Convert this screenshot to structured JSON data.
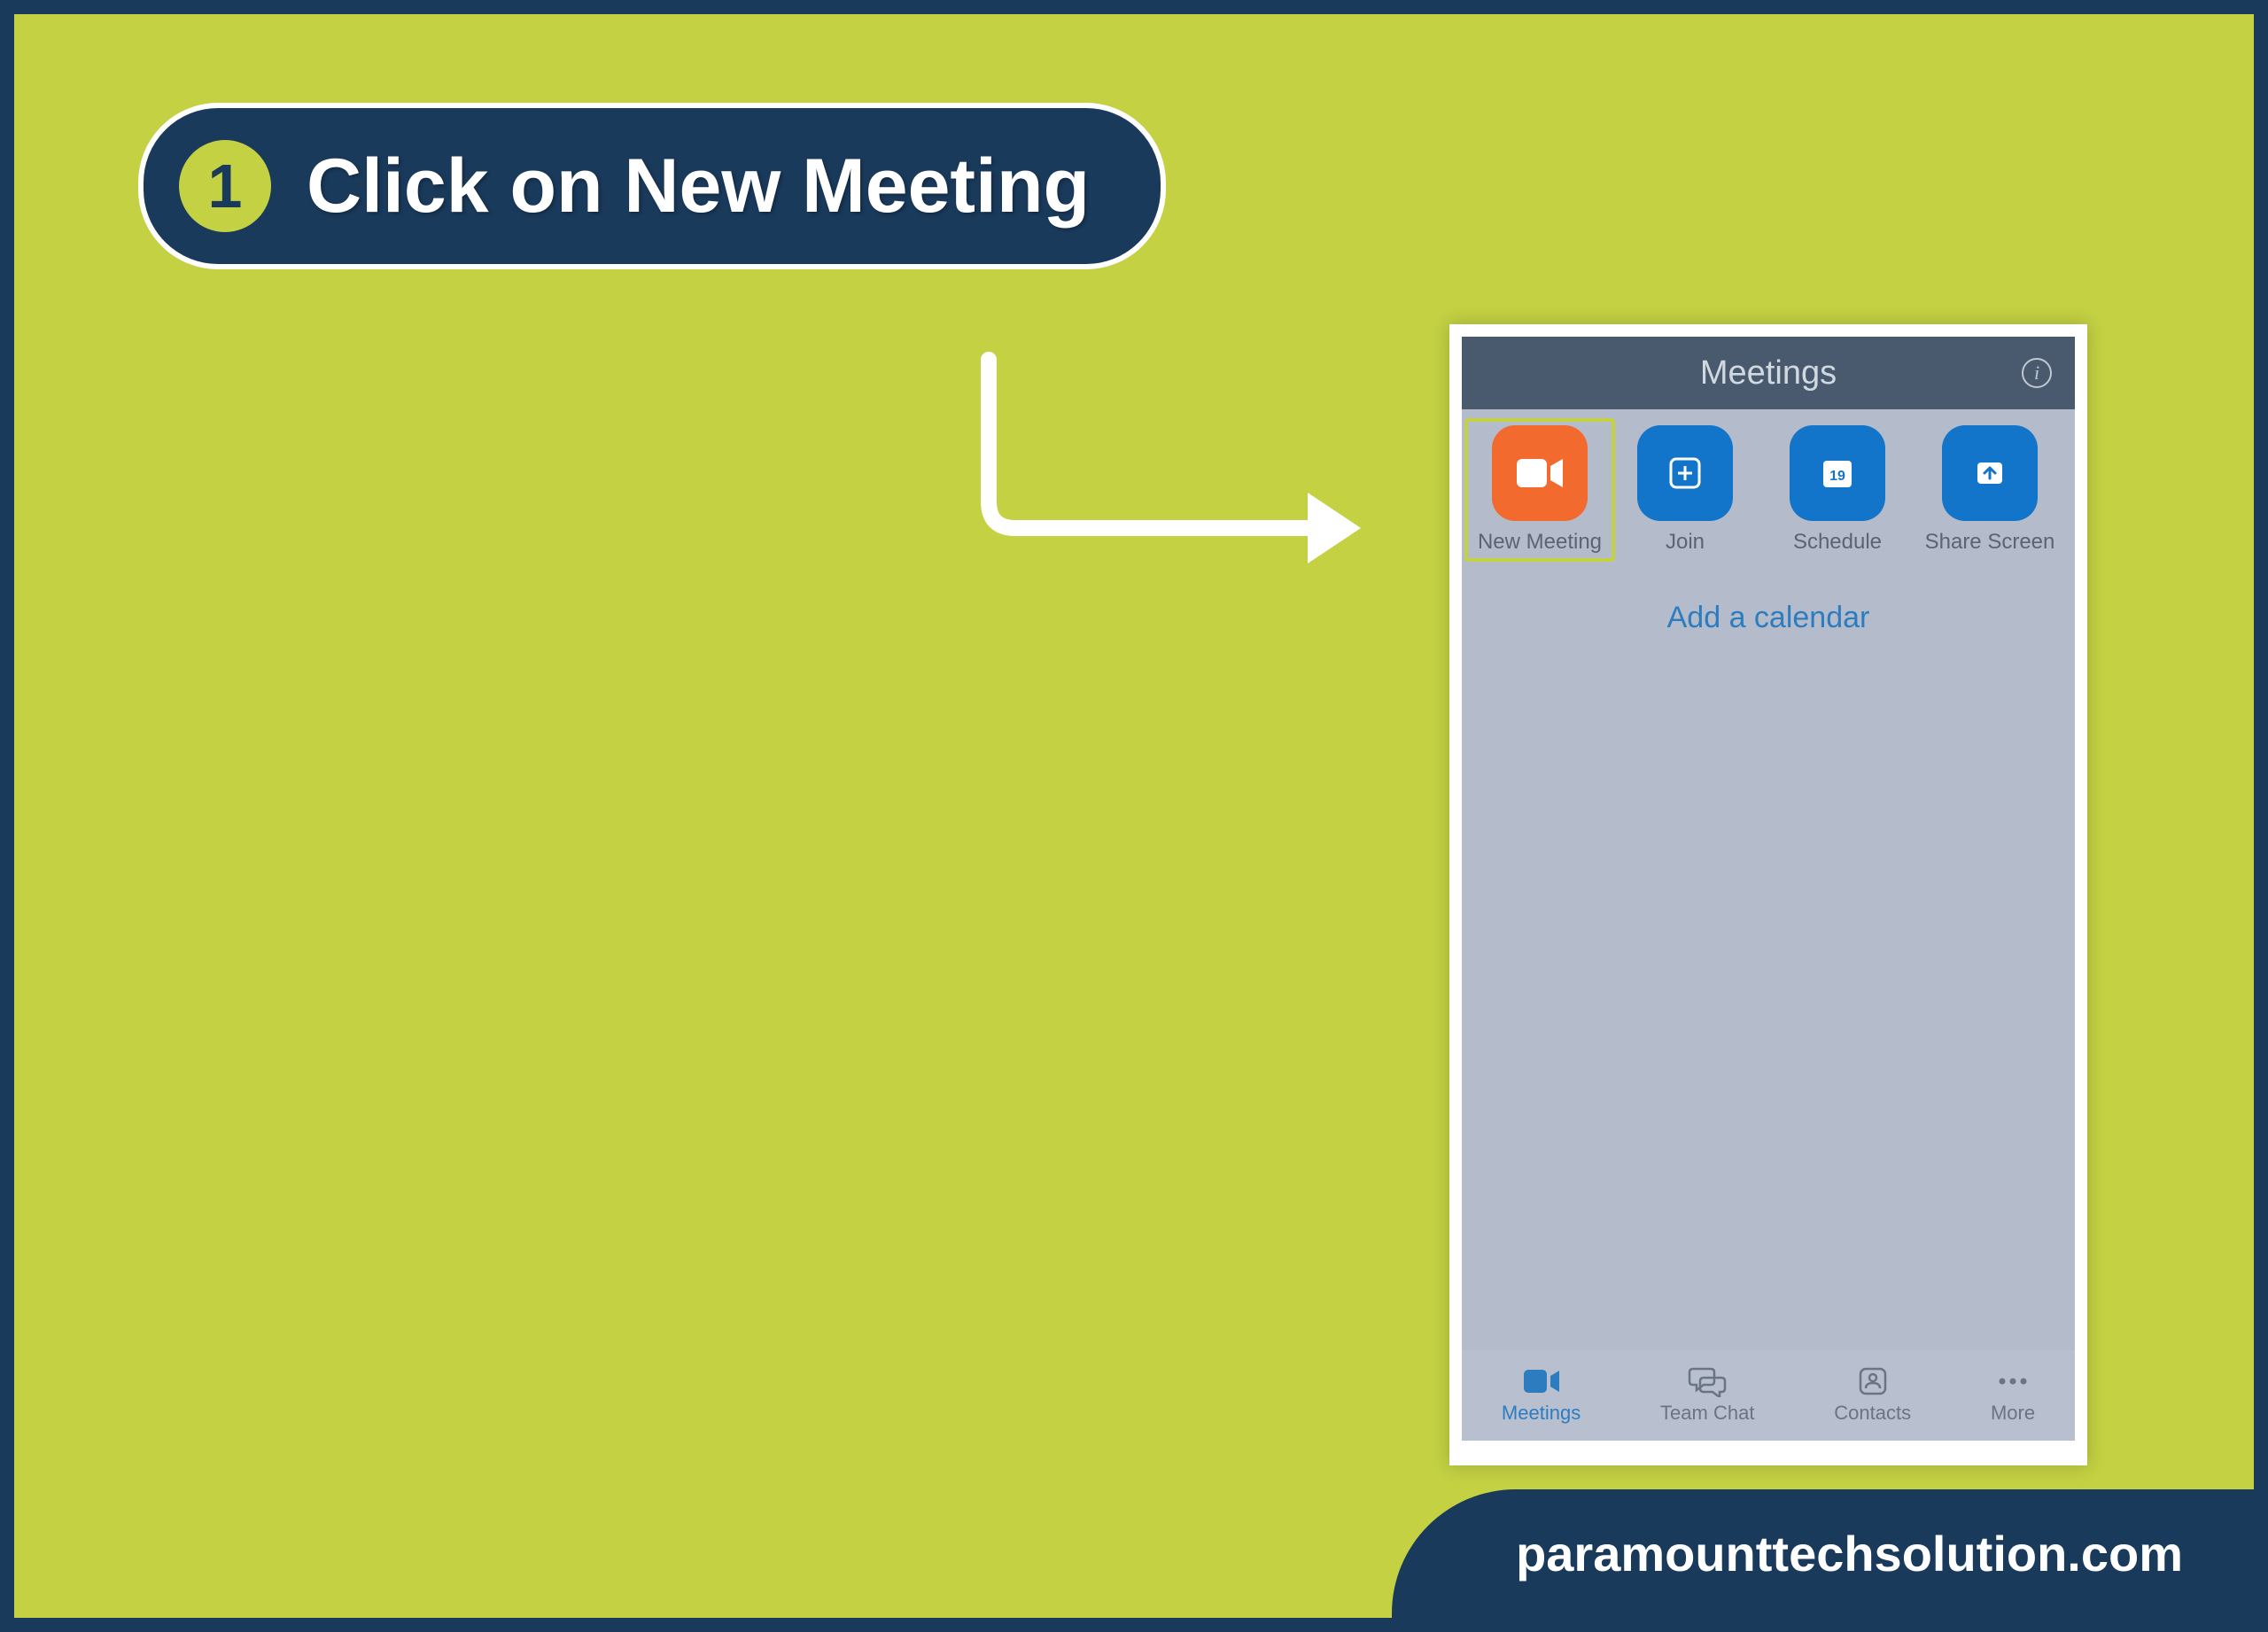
{
  "step": {
    "number": "1",
    "title": "Click on New Meeting"
  },
  "phone": {
    "header_title": "Meetings",
    "info_symbol": "i",
    "actions": {
      "new_meeting": "New Meeting",
      "join": "Join",
      "schedule": "Schedule",
      "schedule_date": "19",
      "share_screen": "Share Screen"
    },
    "add_calendar": "Add a calendar",
    "bottom_nav": {
      "meetings": "Meetings",
      "team_chat": "Team Chat",
      "contacts": "Contacts",
      "more": "More"
    }
  },
  "footer": {
    "url": "paramounttechsolution.com"
  }
}
